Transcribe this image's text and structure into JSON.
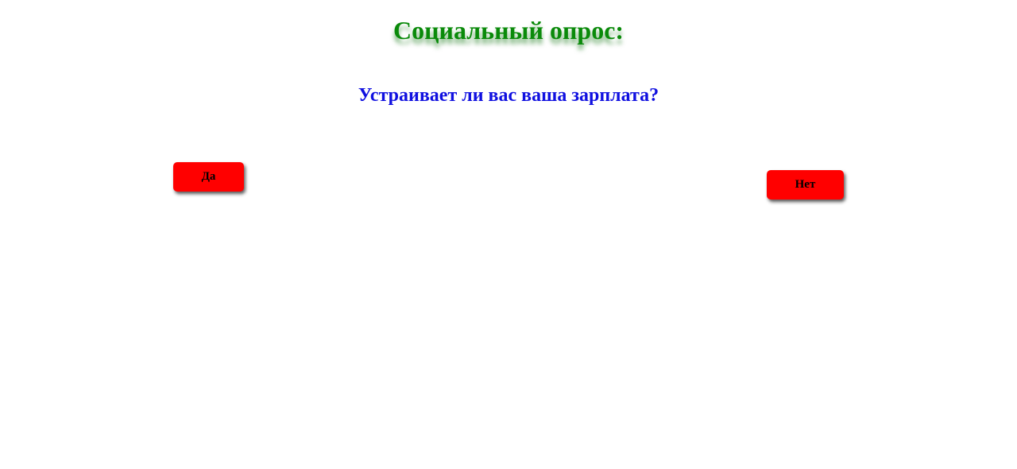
{
  "survey": {
    "title": "Социальный опрос:",
    "question": "Устраивает ли вас ваша зарплата?",
    "yes_label": "Да",
    "no_label": "Нет"
  },
  "colors": {
    "title": "#0a8a0a",
    "question": "#1010e0",
    "button_bg": "#ff0000",
    "background": "#ffffff"
  }
}
